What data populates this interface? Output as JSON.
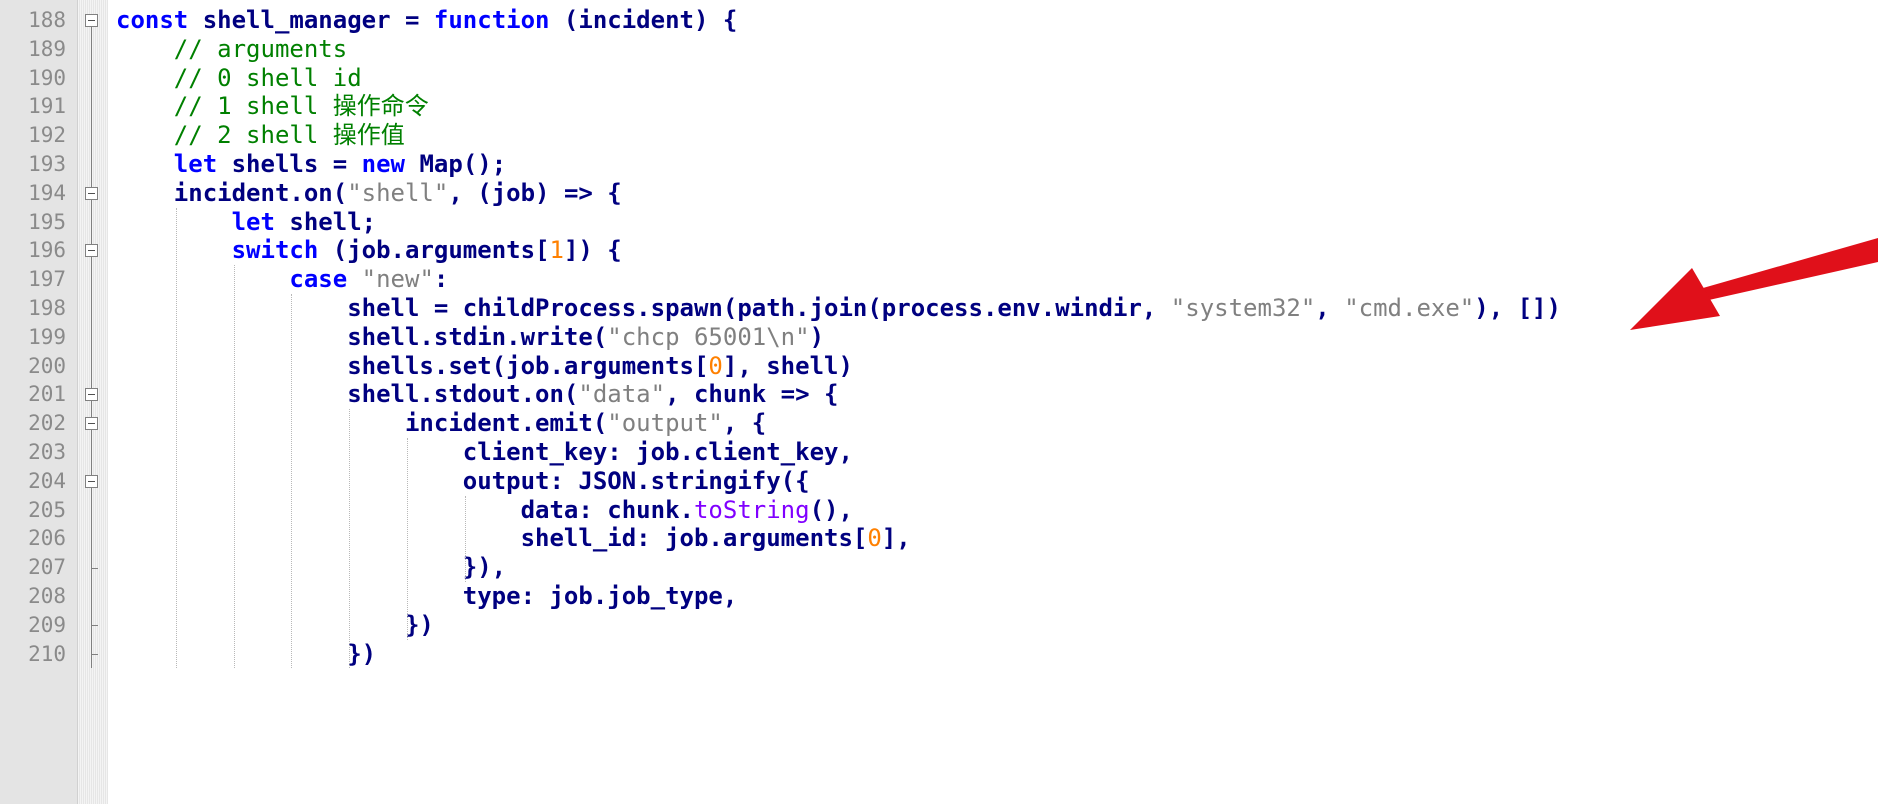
{
  "editor": {
    "lines": [
      {
        "num": "188",
        "tokens": [
          {
            "t": "const",
            "c": "kw"
          },
          {
            "t": " shell_manager = ",
            "c": "plain"
          },
          {
            "t": "function",
            "c": "kw"
          },
          {
            "t": " (incident) {",
            "c": "plain"
          }
        ]
      },
      {
        "num": "189",
        "tokens": [
          {
            "t": "    // arguments",
            "c": "cmt"
          }
        ]
      },
      {
        "num": "190",
        "tokens": [
          {
            "t": "    // 0 shell id",
            "c": "cmt"
          }
        ]
      },
      {
        "num": "191",
        "tokens": [
          {
            "t": "    // 1 shell 操作命令",
            "c": "cmt"
          }
        ]
      },
      {
        "num": "192",
        "tokens": [
          {
            "t": "    // 2 shell 操作值",
            "c": "cmt"
          }
        ]
      },
      {
        "num": "193",
        "tokens": [
          {
            "t": "    ",
            "c": "plain"
          },
          {
            "t": "let",
            "c": "kw"
          },
          {
            "t": " shells = ",
            "c": "plain"
          },
          {
            "t": "new",
            "c": "kw"
          },
          {
            "t": " Map();",
            "c": "plain"
          }
        ]
      },
      {
        "num": "194",
        "tokens": [
          {
            "t": "    incident.on(",
            "c": "plain"
          },
          {
            "t": "\"shell\"",
            "c": "str"
          },
          {
            "t": ", (job) => {",
            "c": "plain"
          }
        ]
      },
      {
        "num": "195",
        "tokens": [
          {
            "t": "        ",
            "c": "plain"
          },
          {
            "t": "let",
            "c": "kw"
          },
          {
            "t": " shell;",
            "c": "plain"
          }
        ]
      },
      {
        "num": "196",
        "tokens": [
          {
            "t": "        ",
            "c": "plain"
          },
          {
            "t": "switch",
            "c": "kw"
          },
          {
            "t": " (job.arguments[",
            "c": "plain"
          },
          {
            "t": "1",
            "c": "num"
          },
          {
            "t": "]) {",
            "c": "plain"
          }
        ]
      },
      {
        "num": "197",
        "tokens": [
          {
            "t": "            ",
            "c": "plain"
          },
          {
            "t": "case",
            "c": "kw"
          },
          {
            "t": " ",
            "c": "plain"
          },
          {
            "t": "\"new\"",
            "c": "str"
          },
          {
            "t": ":",
            "c": "plain"
          }
        ]
      },
      {
        "num": "198",
        "tokens": [
          {
            "t": "                shell = childProcess.spawn(path.join(process.env.windir, ",
            "c": "plain"
          },
          {
            "t": "\"system32\"",
            "c": "str"
          },
          {
            "t": ", ",
            "c": "plain"
          },
          {
            "t": "\"cmd.exe\"",
            "c": "str"
          },
          {
            "t": "), [])",
            "c": "plain"
          }
        ]
      },
      {
        "num": "199",
        "tokens": [
          {
            "t": "                shell.stdin.write(",
            "c": "plain"
          },
          {
            "t": "\"chcp 65001\\n\"",
            "c": "str"
          },
          {
            "t": ")",
            "c": "plain"
          }
        ]
      },
      {
        "num": "200",
        "tokens": [
          {
            "t": "                shells.set(job.arguments[",
            "c": "plain"
          },
          {
            "t": "0",
            "c": "num"
          },
          {
            "t": "], shell)",
            "c": "plain"
          }
        ]
      },
      {
        "num": "201",
        "tokens": [
          {
            "t": "                shell.stdout.on(",
            "c": "plain"
          },
          {
            "t": "\"data\"",
            "c": "str"
          },
          {
            "t": ", chunk => {",
            "c": "plain"
          }
        ]
      },
      {
        "num": "202",
        "tokens": [
          {
            "t": "                    incident.emit(",
            "c": "plain"
          },
          {
            "t": "\"output\"",
            "c": "str"
          },
          {
            "t": ", {",
            "c": "plain"
          }
        ]
      },
      {
        "num": "203",
        "tokens": [
          {
            "t": "                        client_key: job.client_key,",
            "c": "plain"
          }
        ]
      },
      {
        "num": "204",
        "tokens": [
          {
            "t": "                        output: JSON.stringify({",
            "c": "plain"
          }
        ]
      },
      {
        "num": "205",
        "tokens": [
          {
            "t": "                            data: chunk.",
            "c": "plain"
          },
          {
            "t": "toString",
            "c": "method"
          },
          {
            "t": "(),",
            "c": "plain"
          }
        ]
      },
      {
        "num": "206",
        "tokens": [
          {
            "t": "                            shell_id: job.arguments[",
            "c": "plain"
          },
          {
            "t": "0",
            "c": "num"
          },
          {
            "t": "],",
            "c": "plain"
          }
        ]
      },
      {
        "num": "207",
        "tokens": [
          {
            "t": "                        }),",
            "c": "plain"
          }
        ]
      },
      {
        "num": "208",
        "tokens": [
          {
            "t": "                        type: job.job_type,",
            "c": "plain"
          }
        ]
      },
      {
        "num": "209",
        "tokens": [
          {
            "t": "                    })",
            "c": "plain"
          }
        ]
      },
      {
        "num": "210",
        "tokens": [
          {
            "t": "                })",
            "c": "plain"
          }
        ]
      }
    ]
  },
  "colors": {
    "keyword": "#0000ff",
    "default": "#000080",
    "comment": "#008000",
    "string": "#808080",
    "number": "#ff8000",
    "method": "#8000ff",
    "arrow": "#e0101a"
  },
  "icons": {
    "fold_open": "fold-minus-icon",
    "fold_end": "fold-end-icon",
    "annotation": "red-arrow-annotation"
  }
}
